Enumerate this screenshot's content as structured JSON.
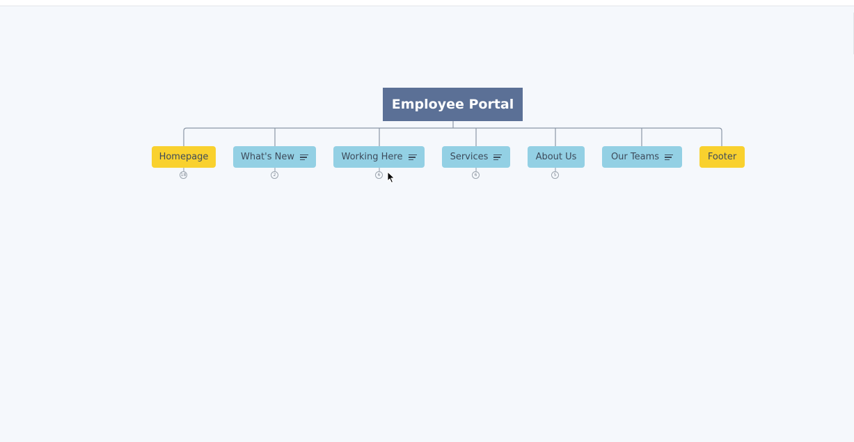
{
  "mindmap": {
    "central_topic": "Employee Portal",
    "topics": [
      {
        "label": "Homepage",
        "color": "#f9d12e",
        "has_notes": false,
        "count": "18"
      },
      {
        "label": "What's New",
        "color": "#93d0e4",
        "has_notes": true,
        "count": "2"
      },
      {
        "label": "Working Here",
        "color": "#93d0e4",
        "has_notes": true,
        "count": "6"
      },
      {
        "label": "Services",
        "color": "#93d0e4",
        "has_notes": true,
        "count": "6"
      },
      {
        "label": "About Us",
        "color": "#93d0e4",
        "has_notes": false,
        "count": "5"
      },
      {
        "label": "Our Teams",
        "color": "#93d0e4",
        "has_notes": true,
        "count": ""
      },
      {
        "label": "Footer",
        "color": "#f9d12e",
        "has_notes": false,
        "count": ""
      }
    ]
  },
  "colors": {
    "central_bg": "#5b7096",
    "canvas_bg": "#f5f8fc",
    "connector": "#8a96a6"
  },
  "icons": {
    "notes": "notes-icon",
    "cursor": "mouse-cursor-icon"
  }
}
